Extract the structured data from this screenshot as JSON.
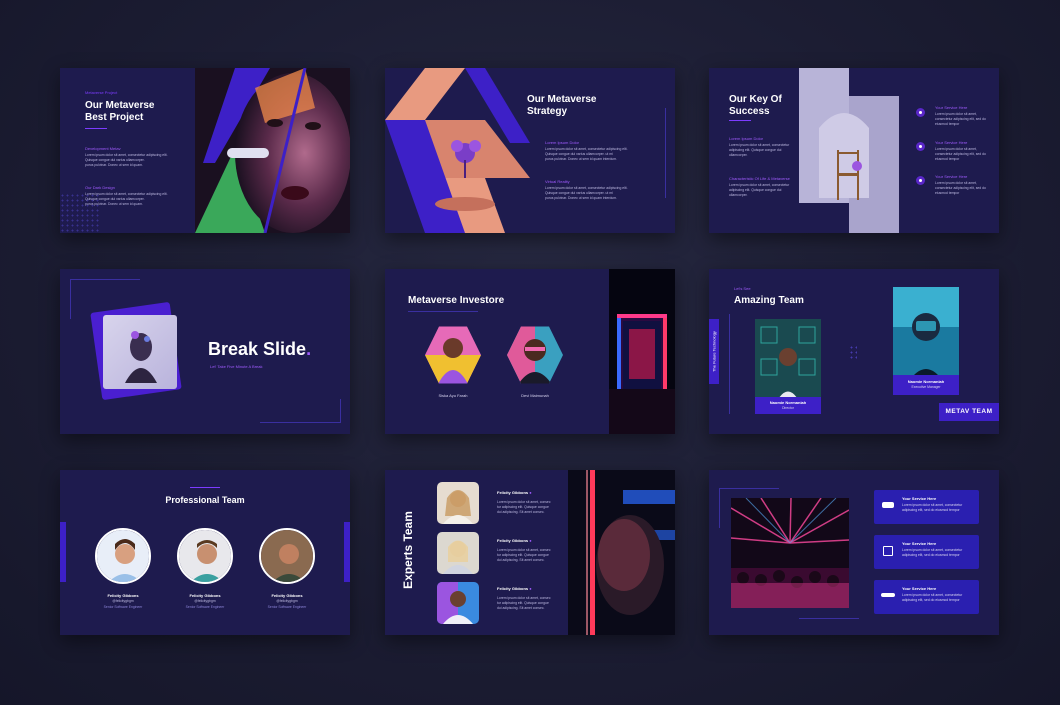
{
  "colors": {
    "background": "#1c1d33",
    "slide": "#1e1b4e",
    "accent": "#a05bff",
    "card": "#2a1fb0"
  },
  "slide1": {
    "title_line1": "Our Metaverse",
    "title_line2": "Best Project",
    "sub1": "Development Metav",
    "body1": [
      "Lorem ipsum dolor sit amet, consectetur adipiscing elit.",
      "Quisque congue dui varius ullamcorper.",
      "purus pulvinar. Donec ut sem id quam."
    ],
    "sub2": "Our Dark Design",
    "body2": [
      "Lorem ipsum dolor sit amet, consectetur adipiscing elit.",
      "Quisque congue dui varius ullamcorper.",
      "purus pulvinar. Donec ut sem id quam."
    ]
  },
  "slide2": {
    "title_line1": "Our Metaverse",
    "title_line2": "Strategy",
    "sub1": "Lorem Ipsum Dolor",
    "body1": [
      "Lorem ipsum dolor sit amet, consectetur adipiscing elit.",
      "Quisque congue dui varius ullamcorper. ut mi",
      "purus pulvinar. Donec ut sem id quam interdum."
    ],
    "sub2": "Virtual Reality",
    "body2": [
      "Lorem ipsum dolor sit amet, consectetur adipiscing elit.",
      "Quisque congue dui varius ullamcorper. ut mi",
      "purus pulvinar. Donec ut sem id quam interdum."
    ]
  },
  "slide3": {
    "title_line1": "Our Key Of",
    "title_line2": "Success",
    "sub1": "Lorem Ipsum Dolor",
    "body1": [
      "Lorem ipsum dolor sit amet, consectetur",
      "adipiscing elit. Quisque congue dui",
      "ullamcorper."
    ],
    "sub2": "Characteristic Of Life & Metaverse",
    "body2": [
      "Lorem ipsum dolor sit amet, consectetur",
      "adipiscing elit. Quisque congue dui",
      "ullamcorper."
    ],
    "items": [
      {
        "label": "Your Service Here",
        "text": [
          "Lorem ipsum dolor sit amet,",
          "consectetur adipiscing elit, sed do",
          "eiusmod tempor"
        ]
      },
      {
        "label": "Your Service Here",
        "text": [
          "Lorem ipsum dolor sit amet,",
          "consectetur adipiscing elit, sed do",
          "eiusmod tempor"
        ]
      },
      {
        "label": "Your Service Here",
        "text": [
          "Lorem ipsum dolor sit amet,",
          "consectetur adipiscing elit, sed do",
          "eiusmod tempor"
        ]
      }
    ]
  },
  "slide4": {
    "title": "Break Slide",
    "title_dot": ".",
    "sub": "Let' Take Five Minute A Break"
  },
  "slide5": {
    "title": "Metaverse Investore",
    "people": [
      {
        "name": "Siska Ayu Farah"
      },
      {
        "name": "Devi Maimunah"
      }
    ]
  },
  "slide6": {
    "sub": "Let's See",
    "title": "Amazing Team",
    "vertical": "The Future Technology",
    "member1": {
      "name": "Naomie Normaniah",
      "role": "Director"
    },
    "member2": {
      "name": "Naomie Normaniah",
      "role": "Executive Manager"
    },
    "badge": "METAV TEAM"
  },
  "slide7": {
    "title": "Professional Team",
    "members": [
      {
        "name": "Felicity Gibbons",
        "handle": "@felicitygbgm",
        "role": "Senior Software Engineer"
      },
      {
        "name": "Felicity Gibbons",
        "handle": "@felicitygbgm",
        "role": "Senior Software Engineer"
      },
      {
        "name": "Felicity Gibbons",
        "handle": "@felicitygbgm",
        "role": "Senior Software Engineer"
      }
    ]
  },
  "slide8": {
    "title": "Experts Team",
    "rows": [
      {
        "name": "Felicity Gibbons",
        "text": [
          "Lorem ipsum dolor sit amet, consec",
          "tur adipiscing elit. Quisque congue",
          "dui adipiscing. Sit amet consec."
        ]
      },
      {
        "name": "Felicity Gibbons",
        "text": [
          "Lorem ipsum dolor sit amet, consec",
          "tur adipiscing elit. Quisque congue",
          "dui adipiscing. Sit amet consec."
        ]
      },
      {
        "name": "Felicity Gibbons",
        "text": [
          "Lorem ipsum dolor sit amet, consec",
          "tur adipiscing elit. Quisque congue",
          "dui adipiscing. Sit amet consec."
        ]
      }
    ]
  },
  "slide9": {
    "cards": [
      {
        "icon": "vr-headset-icon",
        "label": "Your Service Here",
        "text": [
          "Lorem ipsum dolor sit amet, consectetur",
          "adipiscing elit, sed do eiusmod tempor"
        ]
      },
      {
        "icon": "chip-icon",
        "label": "Your Service Here",
        "text": [
          "Lorem ipsum dolor sit amet, consectetur",
          "adipiscing elit, sed do eiusmod tempor"
        ]
      },
      {
        "icon": "drone-icon",
        "label": "Your Service Here",
        "text": [
          "Lorem ipsum dolor sit amet, consectetur",
          "adipiscing elit, sed do eiusmod tempor"
        ]
      }
    ]
  }
}
